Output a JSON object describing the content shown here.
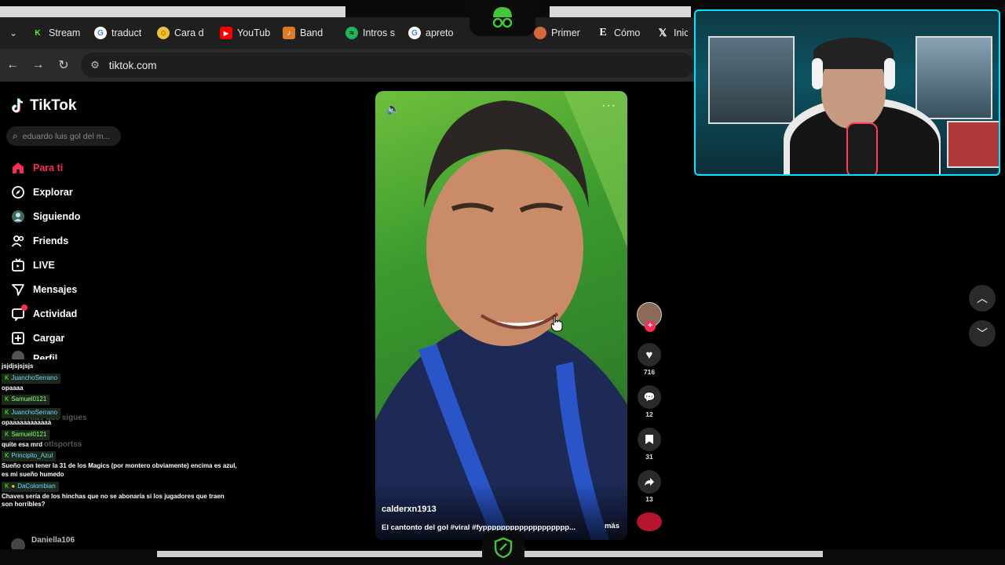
{
  "browser": {
    "tabs": [
      {
        "label": "Stream",
        "icon": "kick-icon",
        "color": "#53fc18"
      },
      {
        "label": "traduct",
        "icon": "google-icon",
        "color": "#ffffff"
      },
      {
        "label": "Cara d",
        "icon": "emoji-icon",
        "color": "#f2c233"
      },
      {
        "label": "YouTub",
        "icon": "youtube-icon",
        "color": "#ff0000"
      },
      {
        "label": "Band",
        "icon": "band-icon",
        "color": "#e07a22"
      },
      {
        "label": "Intros s",
        "icon": "spotify-icon",
        "color": "#1db954"
      },
      {
        "label": "apreto",
        "icon": "google-icon",
        "color": "#ffffff"
      },
      {
        "label": "Primer",
        "icon": "avatar-icon",
        "color": "#d26a3a"
      },
      {
        "label": "Cómo",
        "icon": "e-icon",
        "color": "#ffffff"
      },
      {
        "label": "Inic",
        "icon": "x-icon",
        "color": "#ffffff"
      }
    ],
    "url": "tiktok.com"
  },
  "tiktok": {
    "logo": "TikTok",
    "search_placeholder": "eduardo luis gol del m...",
    "nav": [
      {
        "label": "Para ti",
        "icon": "home-icon",
        "active": true
      },
      {
        "label": "Explorar",
        "icon": "compass-icon"
      },
      {
        "label": "Siguiendo",
        "icon": "following-icon"
      },
      {
        "label": "Friends",
        "icon": "friends-icon"
      },
      {
        "label": "LIVE",
        "icon": "live-icon"
      },
      {
        "label": "Mensajes",
        "icon": "message-icon"
      },
      {
        "label": "Actividad",
        "icon": "activity-icon"
      },
      {
        "label": "Cargar",
        "icon": "upload-icon"
      },
      {
        "label": "Perfil",
        "icon": "profile-icon"
      }
    ],
    "following_header": "Cuentas que sigues",
    "following_partial": [
      "otlsportss",
      "Daniella106"
    ],
    "video": {
      "username": "calderxn1913",
      "description": "El cantonto del gol #viral #fyppppppppppppppppppp...",
      "more": "más"
    },
    "actions": {
      "likes": "716",
      "comments": "12",
      "saves": "31",
      "shares": "13"
    }
  },
  "chat": [
    {
      "user": "",
      "text": "jsjdjsjsjsjs"
    },
    {
      "user": "JuanchoSerrano",
      "text": "opaaaa"
    },
    {
      "user": "Samuel0121",
      "text": ""
    },
    {
      "user": "JuanchoSerrano",
      "text": "opaaaaaaaaaaaa"
    },
    {
      "user": "Samuel0121",
      "text": "quite esa mrd"
    },
    {
      "user": "Principito_Azul",
      "text": "Sueño con tener la 31 de los Magics (por montero obviamente) encima es azul, es mi sueño humedo"
    },
    {
      "user": "DaColombian",
      "text": "Chaves sería de los hinchas que no se abonaría si los jugadores que traen son horribles?"
    }
  ]
}
